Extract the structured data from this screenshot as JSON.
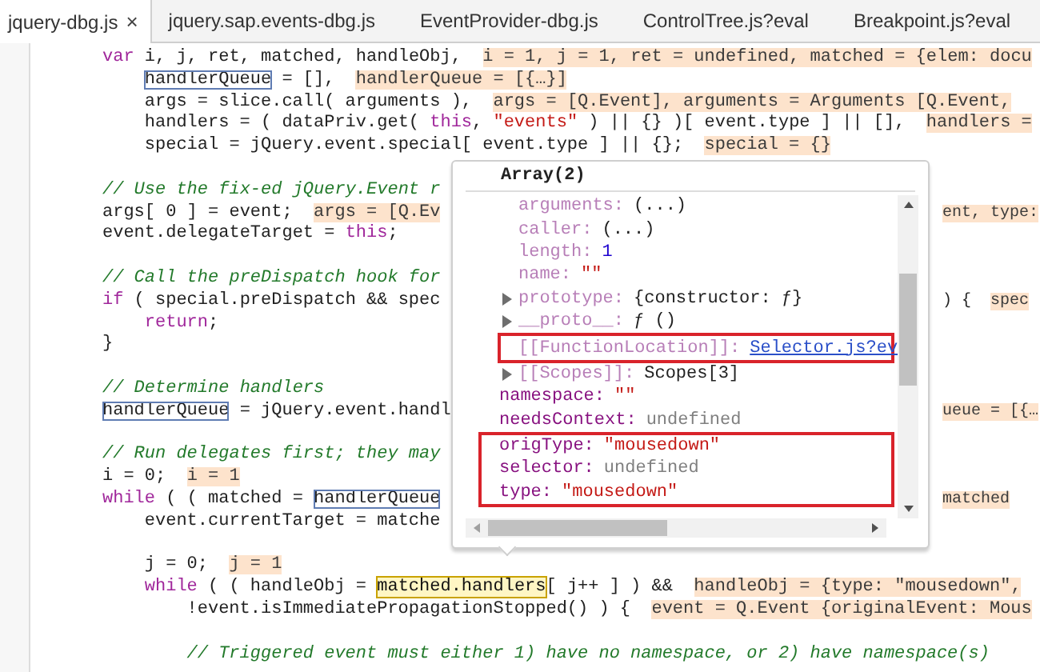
{
  "tabs": [
    {
      "label": "jquery-dbg.js",
      "selected": true,
      "closable": true
    },
    {
      "label": "jquery.sap.events-dbg.js",
      "selected": false,
      "closable": false
    },
    {
      "label": "EventProvider-dbg.js",
      "selected": false,
      "closable": false
    },
    {
      "label": "ControlTree.js?eval",
      "selected": false,
      "closable": false
    },
    {
      "label": "Breakpoint.js?eval",
      "selected": false,
      "closable": false
    }
  ],
  "close_glyph": "×",
  "code_lines": [
    {
      "gap_before": false,
      "code": [
        {
          "kind": "keyword",
          "text": "var"
        },
        {
          "kind": "plain",
          "text": " i, j, ret, matched, handleObj,  "
        },
        {
          "kind": "value",
          "text": "i = 1, j = 1, ret = undefined, matched = {elem: docu"
        }
      ],
      "children": [
        {
          "gap_before": false,
          "code": [
            {
              "kind": "boxed",
              "text": "handlerQueue"
            },
            {
              "kind": "plain",
              "text": " = [],  "
            },
            {
              "kind": "value",
              "text": "handlerQueue = [{…}]"
            }
          ]
        },
        {
          "gap_before": false,
          "code": [
            {
              "kind": "plain",
              "text": "args = slice.call( arguments ),  "
            },
            {
              "kind": "value",
              "text": "args = [Q.Event], arguments = Arguments [Q.Event,"
            }
          ]
        },
        {
          "gap_before": false,
          "code": [
            {
              "kind": "plain",
              "text": "handlers = ( dataPriv.get( "
            },
            {
              "kind": "keyword",
              "text": "this"
            },
            {
              "kind": "plain",
              "text": ", "
            },
            {
              "kind": "string",
              "text": "\"events\""
            },
            {
              "kind": "plain",
              "text": " ) || {} )[ event.type ] || [],  "
            },
            {
              "kind": "value",
              "text": "handlers ="
            }
          ]
        },
        {
          "gap_before": false,
          "code": [
            {
              "kind": "plain",
              "text": "special = jQuery.event.special[ event.type ] || {};  "
            },
            {
              "kind": "value",
              "text": "special = {}"
            }
          ]
        }
      ]
    },
    {
      "gap_before": true,
      "code": [
        {
          "kind": "comment",
          "text": "// Use the fix-ed jQuery.Event r"
        }
      ]
    },
    {
      "gap_before": false,
      "code": [
        {
          "kind": "plain",
          "text": "args[ 0 ] = event;  "
        },
        {
          "kind": "value",
          "text": "args = [Q.Ev"
        }
      ],
      "after_popup": [
        {
          "kind": "value",
          "text": "ent, type:"
        }
      ]
    },
    {
      "gap_before": false,
      "code": [
        {
          "kind": "plain",
          "text": "event.delegateTarget = "
        },
        {
          "kind": "keyword",
          "text": "this"
        },
        {
          "kind": "plain",
          "text": ";"
        }
      ]
    },
    {
      "gap_before": true,
      "code": [
        {
          "kind": "comment",
          "text": "// Call the preDispatch hook for"
        }
      ]
    },
    {
      "gap_before": false,
      "code": [
        {
          "kind": "keyword",
          "text": "if"
        },
        {
          "kind": "plain",
          "text": " ( special.preDispatch && spec"
        }
      ],
      "after_popup": [
        {
          "kind": "plain",
          "text": ") {  "
        },
        {
          "kind": "value",
          "text": "spec"
        }
      ],
      "children": [
        {
          "gap_before": false,
          "code": [
            {
              "kind": "keyword",
              "text": "return"
            },
            {
              "kind": "plain",
              "text": ";"
            }
          ]
        }
      ]
    },
    {
      "gap_before": false,
      "code": [
        {
          "kind": "plain",
          "text": "}"
        }
      ]
    },
    {
      "gap_before": true,
      "code": [
        {
          "kind": "comment",
          "text": "// Determine handlers"
        }
      ]
    },
    {
      "gap_before": false,
      "code": [
        {
          "kind": "boxed",
          "text": "handlerQueue"
        },
        {
          "kind": "plain",
          "text": " = jQuery.event.handl"
        }
      ],
      "after_popup": [
        {
          "kind": "value",
          "text": "ueue = [{…"
        }
      ]
    },
    {
      "gap_before": true,
      "code": [
        {
          "kind": "comment",
          "text": "// Run delegates first; they may"
        }
      ]
    },
    {
      "gap_before": false,
      "code": [
        {
          "kind": "plain",
          "text": "i = 0;  "
        },
        {
          "kind": "value",
          "text": "i = 1"
        }
      ]
    },
    {
      "gap_before": false,
      "code": [
        {
          "kind": "keyword",
          "text": "while"
        },
        {
          "kind": "plain",
          "text": " ( ( matched = "
        },
        {
          "kind": "boxed",
          "text": "handlerQueue"
        }
      ],
      "after_popup": [
        {
          "kind": "value",
          "text": "matched"
        }
      ],
      "children": [
        {
          "gap_before": false,
          "code": [
            {
              "kind": "plain",
              "text": "event.currentTarget = matche"
            }
          ]
        },
        {
          "gap_before": true,
          "code": [
            {
              "kind": "plain",
              "text": "j = 0;  "
            },
            {
              "kind": "value",
              "text": "j = 1"
            }
          ]
        },
        {
          "gap_before": false,
          "code": [
            {
              "kind": "keyword",
              "text": "while"
            },
            {
              "kind": "plain",
              "text": " ( ( handleObj = "
            },
            {
              "kind": "hovered",
              "text": "matched.handlers"
            },
            {
              "kind": "plain",
              "text": "[ j++ ] ) &&  "
            },
            {
              "kind": "value",
              "text": "handleObj = {type: \"mousedown\","
            }
          ],
          "children": [
            {
              "gap_before": false,
              "code": [
                {
                  "kind": "plain",
                  "text": "!event.isImmediatePropagationStopped() ) {  "
                },
                {
                  "kind": "value",
                  "text": "event = Q.Event {originalEvent: Mous"
                }
              ]
            },
            {
              "gap_before": true,
              "code": [
                {
                  "kind": "comment",
                  "text": "// Triggered event must either 1) have no namespace, or 2) have namespace(s)"
                }
              ]
            }
          ]
        }
      ]
    }
  ],
  "popup": {
    "title": "Array(2)",
    "tree": [
      {
        "children": [
          {
            "key": "arguments:",
            "value": "(...)",
            "kind": "plain",
            "dimmed": true,
            "expandable": false,
            "outlined": false
          },
          {
            "key": "caller:",
            "value": "(...)",
            "kind": "plain",
            "dimmed": true,
            "expandable": false,
            "outlined": false
          },
          {
            "key": "length:",
            "value": "1",
            "kind": "number",
            "dimmed": true,
            "expandable": false,
            "outlined": false
          },
          {
            "key": "name:",
            "value": "\"\"",
            "kind": "string",
            "dimmed": true,
            "expandable": false,
            "outlined": false
          },
          {
            "key": "prototype:",
            "value": "{constructor: ƒ}",
            "kind": "plain",
            "dimmed": true,
            "expandable": true,
            "outlined": false
          },
          {
            "key": "__proto__:",
            "value": "ƒ ()",
            "kind": "plain",
            "dimmed": true,
            "expandable": true,
            "outlined": false
          },
          {
            "key": "[[FunctionLocation]]:",
            "value": "Selector.js?ev",
            "kind": "link",
            "dimmed": true,
            "expandable": false,
            "outlined": true
          },
          {
            "key": "[[Scopes]]:",
            "value": "Scopes[3]",
            "kind": "plain",
            "dimmed": true,
            "expandable": true,
            "outlined": false
          }
        ]
      },
      {
        "key": "namespace:",
        "value": "\"\"",
        "kind": "string",
        "dimmed": false,
        "expandable": false,
        "outlined": false
      },
      {
        "key": "needsContext:",
        "value": "undefined",
        "kind": "undefined",
        "dimmed": false,
        "expandable": false,
        "outlined": false
      },
      {
        "key": "origType:",
        "value": "\"mousedown\"",
        "kind": "string",
        "dimmed": false,
        "expandable": false,
        "outlined": true
      },
      {
        "key": "selector:",
        "value": "undefined",
        "kind": "undefined",
        "dimmed": false,
        "expandable": false,
        "outlined": true
      },
      {
        "key": "type:",
        "value": "\"mousedown\"",
        "kind": "string",
        "dimmed": false,
        "expandable": false,
        "outlined": true
      }
    ]
  }
}
